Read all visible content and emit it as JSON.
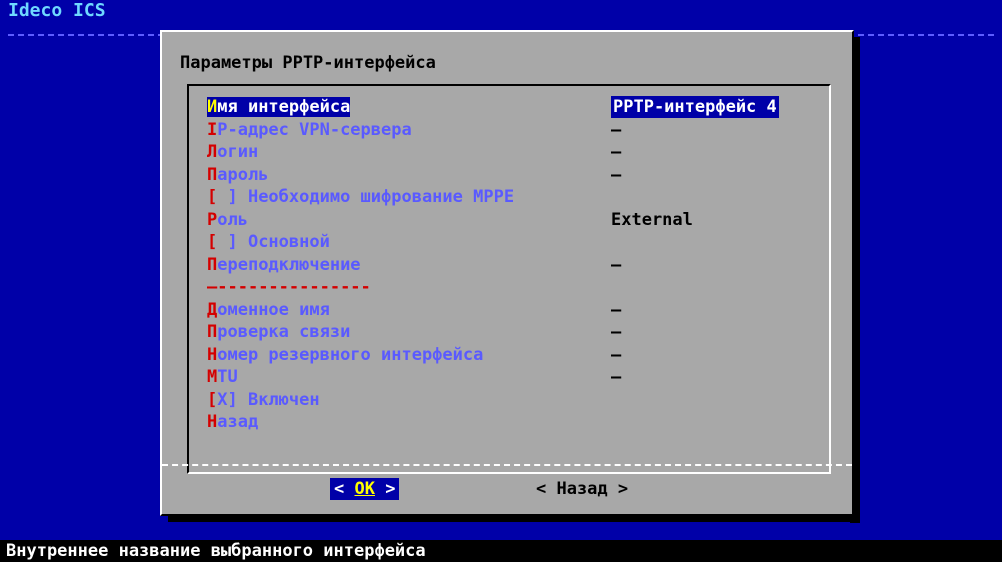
{
  "app_title": "Ideco ICS",
  "dialog": {
    "title": "Параметры PPTP-интерфейса",
    "items": [
      {
        "hot": "И",
        "rest": "мя интерфейса",
        "value": "PPTP-интерфейс 4",
        "selected": true
      },
      {
        "hot": "I",
        "rest": "P-адрес VPN-сервера",
        "value": "–"
      },
      {
        "hot": "Л",
        "rest": "огин",
        "value": "–"
      },
      {
        "hot": "П",
        "rest": "ароль",
        "value": "–"
      },
      {
        "hot": "[",
        "rest": " ] Необходимо шифрование MPPE",
        "value": ""
      },
      {
        "hot": "Р",
        "rest": "оль",
        "value": "External"
      },
      {
        "hot": "[",
        "rest": " ] Основной",
        "value": ""
      },
      {
        "hot": "П",
        "rest": "ереподключение",
        "value": "–"
      },
      {
        "hot": "–",
        "rest": "",
        "value": "",
        "separator": "---------------"
      },
      {
        "hot": "Д",
        "rest": "оменное имя",
        "value": "–"
      },
      {
        "hot": "П",
        "rest": "роверка связи",
        "value": "–"
      },
      {
        "hot": "Н",
        "rest": "омер резервного интерфейса",
        "value": "–"
      },
      {
        "hot": "M",
        "rest": "TU",
        "value": "–"
      },
      {
        "hot": "[",
        "rest": "X] Включен",
        "value": ""
      },
      {
        "hot": "Н",
        "rest": "азад",
        "value": ""
      }
    ],
    "ok_button": {
      "left": "<  ",
      "hot": "OK",
      "right": "    >"
    },
    "back_button": "< Назад >"
  },
  "status_bar": "Внутреннее название выбранного интерфейса",
  "colors": {
    "background": "#0000a8",
    "dialog": "#a8a8a8",
    "hotkey": "#d40000",
    "item_text": "#5a5aff",
    "selected_hotkey": "#ffff00"
  }
}
